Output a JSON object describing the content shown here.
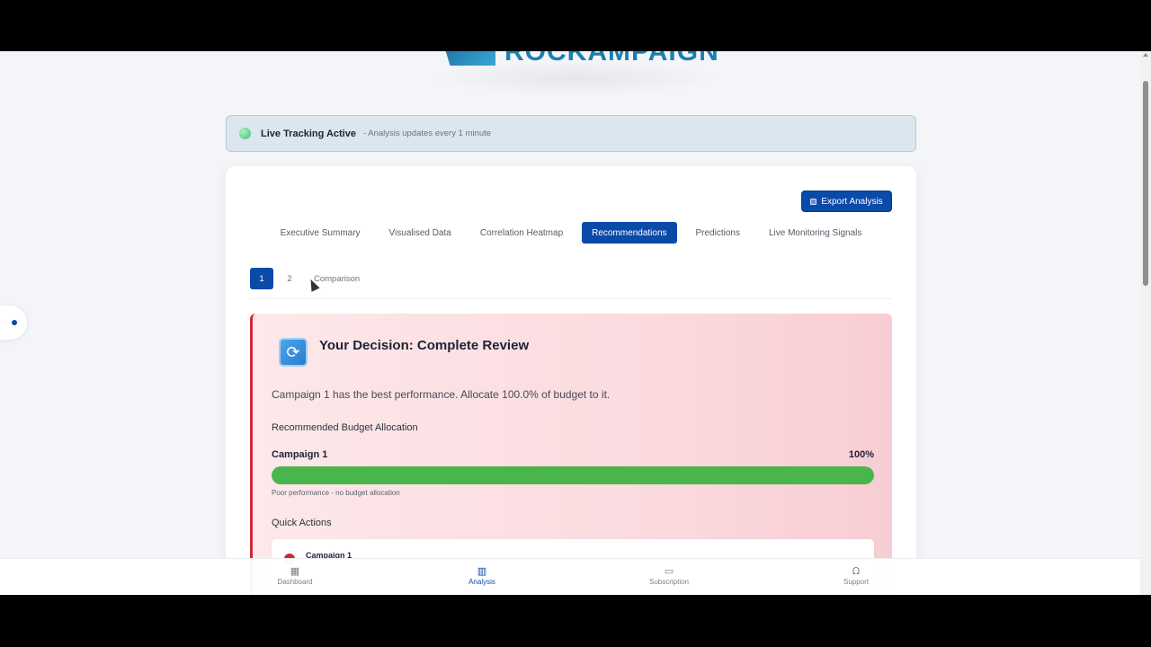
{
  "brand": {
    "logo_text": "ROCKAMPAIGN"
  },
  "live": {
    "title": "Live Tracking Active",
    "subtitle": "- Analysis updates every 1 minute",
    "status_color": "#3fbf76"
  },
  "toolbar": {
    "export_label": "Export Analysis"
  },
  "tabs": [
    {
      "label": "Executive Summary",
      "active": false
    },
    {
      "label": "Visualised Data",
      "active": false
    },
    {
      "label": "Correlation Heatmap",
      "active": false
    },
    {
      "label": "Recommendations",
      "active": true
    },
    {
      "label": "Predictions",
      "active": false
    },
    {
      "label": "Live Monitoring Signals",
      "active": false
    }
  ],
  "subtabs": [
    {
      "label": "1",
      "active": true
    },
    {
      "label": "2",
      "active": false
    },
    {
      "label": "Comparison",
      "active": false
    }
  ],
  "decision": {
    "icon": "refresh-icon",
    "title": "Your Decision: Complete Review",
    "text": "Campaign 1 has the best performance. Allocate 100.0% of budget to it.",
    "allocation_label": "Recommended Budget Allocation",
    "allocation": {
      "campaign": "Campaign 1",
      "percent_label": "100%",
      "fraction": 1.0,
      "note": "Poor performance - no budget allocation"
    },
    "quick_actions_label": "Quick Actions",
    "quick_action_campaign": "Campaign 1"
  },
  "nav": [
    {
      "label": "Dashboard",
      "icon": "grid-icon",
      "active": false
    },
    {
      "label": "Analysis",
      "icon": "bar-chart-icon",
      "active": true
    },
    {
      "label": "Subscription",
      "icon": "credit-card-icon",
      "active": false
    },
    {
      "label": "Support",
      "icon": "headphones-icon",
      "active": false
    }
  ],
  "colors": {
    "primary": "#0a4aa8",
    "danger": "#d32737",
    "success_bar": "#49b54c",
    "banner_bg": "#dbe6ef"
  }
}
